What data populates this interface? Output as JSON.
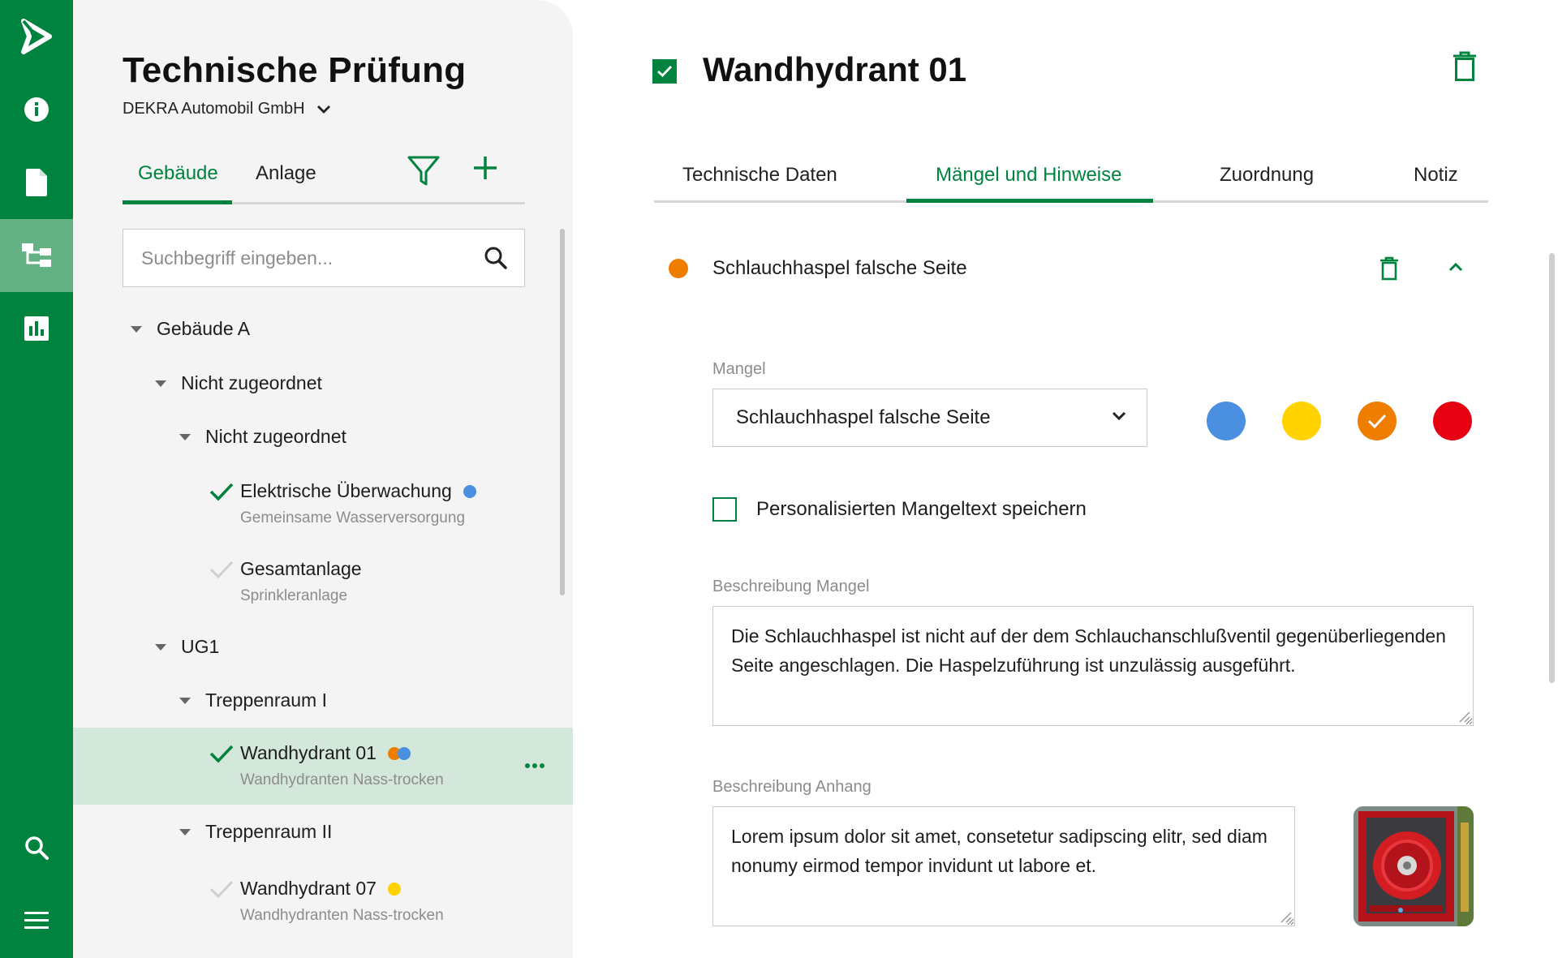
{
  "rail": {
    "items": [
      {
        "name": "logo",
        "icon": "play-logo-icon"
      },
      {
        "name": "info",
        "icon": "info-icon"
      },
      {
        "name": "document",
        "icon": "document-icon"
      },
      {
        "name": "structure",
        "icon": "hierarchy-icon",
        "active": true
      },
      {
        "name": "reports",
        "icon": "bar-chart-icon"
      },
      {
        "name": "search",
        "icon": "search-icon"
      },
      {
        "name": "menu",
        "icon": "menu-icon"
      }
    ]
  },
  "sidebar": {
    "title": "Technische Prüfung",
    "company": "DEKRA Automobil GmbH",
    "tabs": [
      {
        "label": "Gebäude",
        "active": true
      },
      {
        "label": "Anlage",
        "active": false
      }
    ],
    "search_placeholder": "Suchbegriff eingeben...",
    "tree": {
      "building_a": "Gebäude A",
      "unassigned_1": "Nicht zugeordnet",
      "unassigned_2": "Nicht zugeordnet",
      "item1": {
        "title": "Elektrische Überwachung",
        "subtitle": "Gemeinsame Wasserversorgung",
        "checked": true
      },
      "item2": {
        "title": "Gesamtanlage",
        "subtitle": "Sprinkleranlage",
        "checked": false
      },
      "ug1": "UG1",
      "stair1": "Treppenraum I",
      "item3": {
        "title": "Wandhydrant 01",
        "subtitle": "Wandhydranten Nass-trocken",
        "checked": true,
        "selected": true
      },
      "stair2": "Treppenraum II",
      "item4": {
        "title": "Wandhydrant 07",
        "subtitle": "Wandhydranten Nass-trocken",
        "checked": false
      }
    }
  },
  "detail": {
    "title": "Wandhydrant 01",
    "tabs": [
      {
        "label": "Technische Daten",
        "active": false
      },
      {
        "label": "Mängel und Hinweise",
        "active": true
      },
      {
        "label": "Zuordnung",
        "active": false
      },
      {
        "label": "Notiz",
        "active": false
      }
    ],
    "defect": {
      "title": "Schlauchhaspel falsche Seite",
      "mangel_label": "Mangel",
      "mangel_value": "Schlauchhaspel falsche Seite",
      "severity_selected": "orange",
      "save_custom_label": "Personalisierten Mangeltext speichern",
      "beschreibung_mangel_label": "Beschreibung Mangel",
      "beschreibung_mangel": "Die Schlauchhaspel ist nicht auf der dem Schlauchanschlußventil gegenüberliegenden Seite angeschlagen. Die Haspelzuführung ist unzulässig ausgeführt.",
      "beschreibung_anhang_label": "Beschreibung Anhang",
      "beschreibung_anhang": "Lorem ipsum dolor sit amet, consetetur sadipscing elitr, sed diam nonumy eirmod tempor invidunt ut labore et."
    }
  },
  "colors": {
    "brand_green": "#00833e",
    "active_rail": "#64b283",
    "selected_row": "#d3e8da",
    "blue": "#4a8fe0",
    "yellow": "#ffd200",
    "orange": "#ef7d00",
    "red": "#e60012"
  }
}
